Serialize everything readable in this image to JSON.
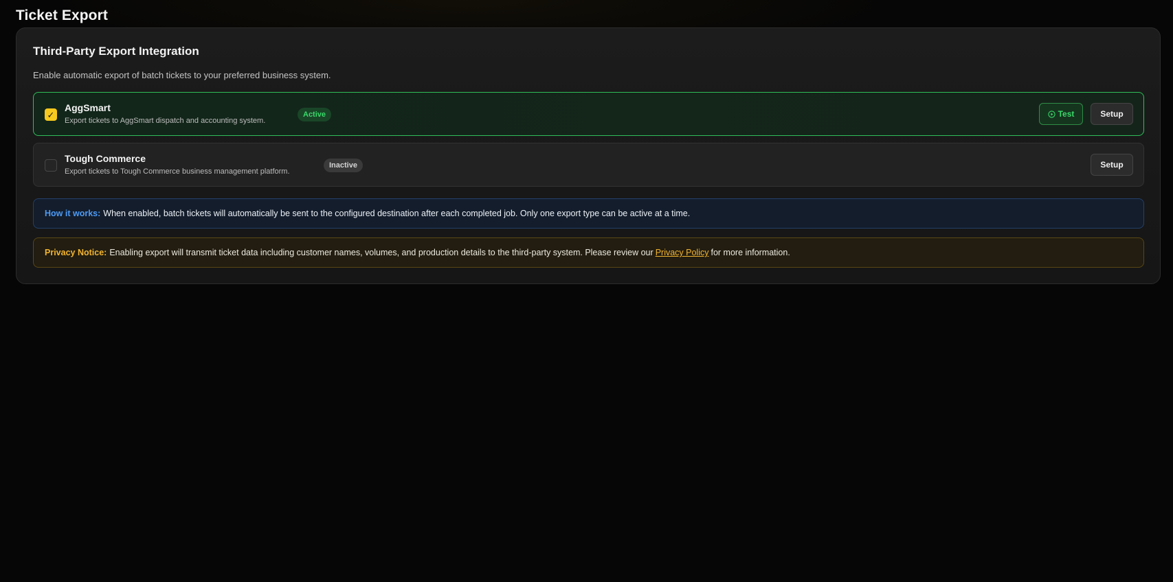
{
  "page": {
    "title": "Ticket Export"
  },
  "section": {
    "title": "Third-Party Export Integration",
    "description": "Enable automatic export of batch tickets to your preferred business system."
  },
  "integrations": [
    {
      "name": "AggSmart",
      "description": "Export tickets to AggSmart dispatch and accounting system.",
      "status": "Active",
      "enabled": true,
      "test_label": "Test",
      "setup_label": "Setup"
    },
    {
      "name": "Tough Commerce",
      "description": "Export tickets to Tough Commerce business management platform.",
      "status": "Inactive",
      "enabled": false,
      "setup_label": "Setup"
    }
  ],
  "info_notice": {
    "lead": "How it works:",
    "text": "When enabled, batch tickets will automatically be sent to the configured destination after each completed job. Only one export type can be active at a time."
  },
  "privacy_notice": {
    "lead": "Privacy Notice:",
    "text_before": "Enabling export will transmit ticket data including customer names, volumes, and production details to the third-party system. Please review our",
    "link": "Privacy Policy",
    "text_after": "for more information."
  },
  "icons": {
    "checkbox_checked": "check-icon",
    "test_button": "play-circle-icon"
  },
  "colors": {
    "accent_yellow": "#f7c91e",
    "active_green": "#3ad86a",
    "info_blue": "#4d9bf5",
    "privacy_amber": "#f2b431"
  }
}
